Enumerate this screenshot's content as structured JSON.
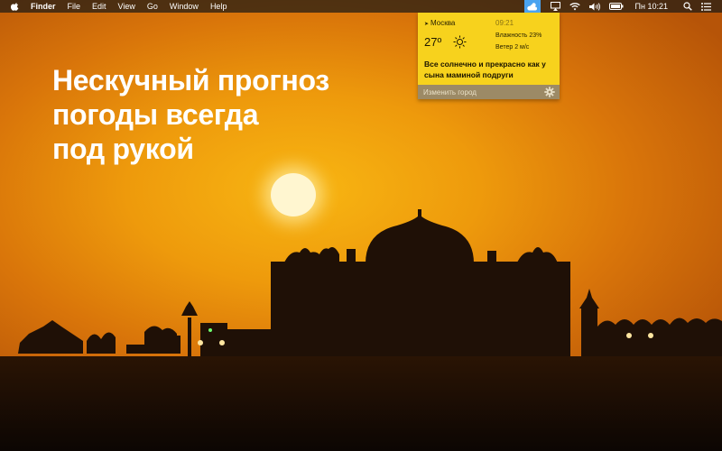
{
  "menubar": {
    "app_name": "Finder",
    "menus": [
      "File",
      "Edit",
      "View",
      "Go",
      "Window",
      "Help"
    ],
    "clock": "Пн 10:21",
    "accent_color": "#4aa3f0"
  },
  "weather_popup": {
    "city": "Москва",
    "time": "09:21",
    "temperature": "27º",
    "condition_icon": "sun-icon",
    "humidity": "Влажность 23%",
    "wind": "Ветер 2 м/с",
    "message": "Все солнечно и прекрасно как у сына маминой подруги",
    "change_city_label": "Изменить город",
    "background_color": "#f7d21d"
  },
  "headline": {
    "lines": [
      "Нескучный прогноз",
      "погоды всегда",
      "под рукой"
    ]
  }
}
